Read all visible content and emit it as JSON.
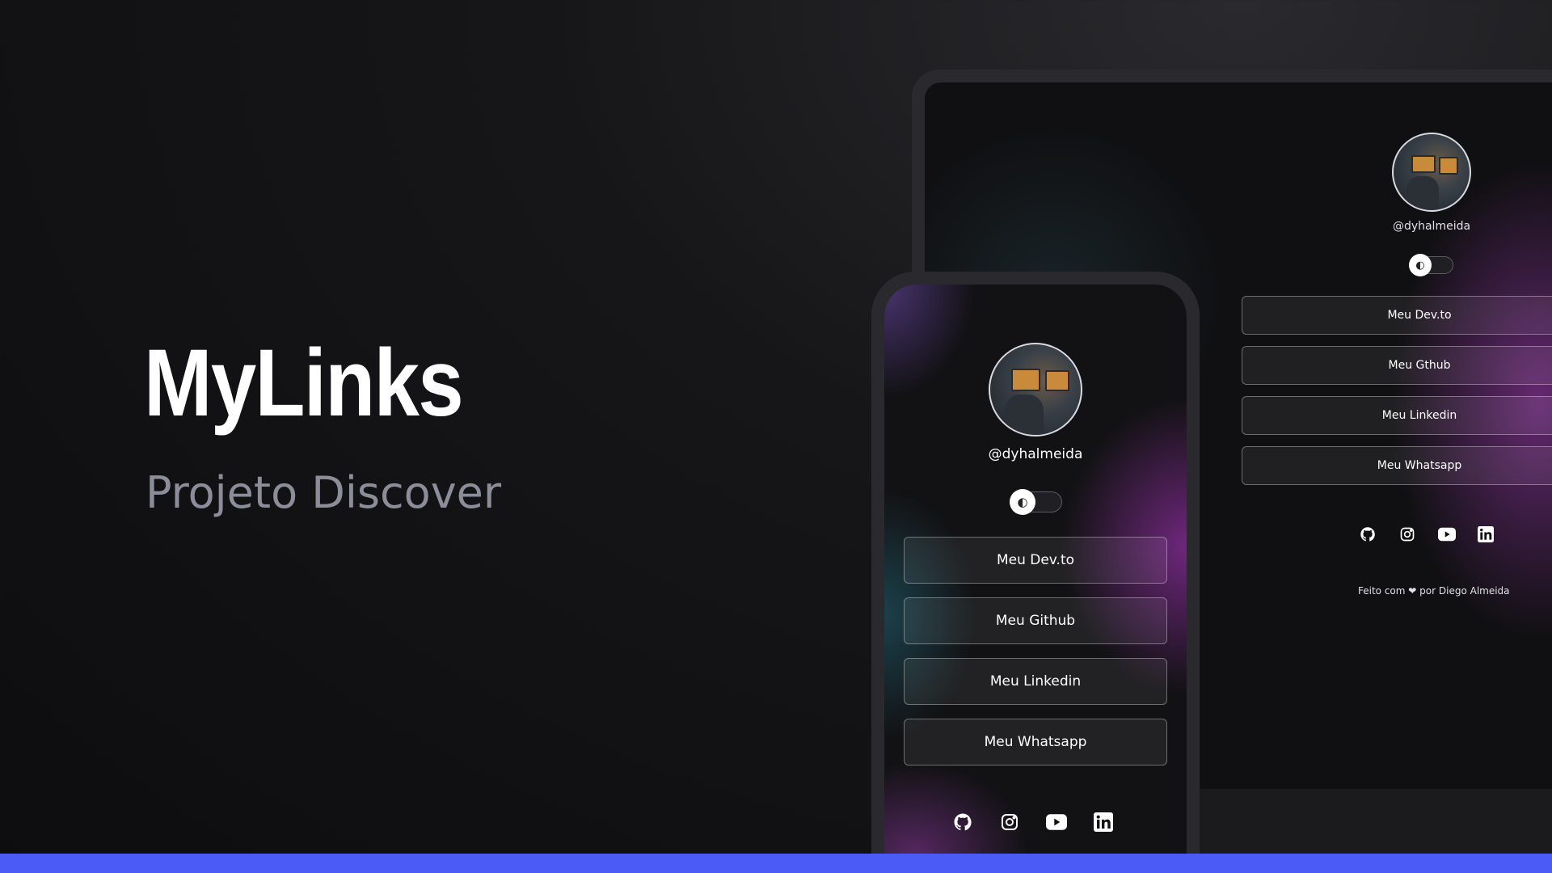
{
  "hero": {
    "title": "MyLinks",
    "subtitle": "Projeto Discover"
  },
  "profile": {
    "username": "@dyhalmeida",
    "avatar": "avatar-photo"
  },
  "theme_toggle": {
    "icon": "moon-sun-icon",
    "state": "off"
  },
  "links": [
    {
      "label": "Meu Dev.to"
    },
    {
      "label": "Meu Github"
    },
    {
      "label": "Meu Linkedin"
    },
    {
      "label": "Meu Whatsapp"
    }
  ],
  "desktop_links": [
    {
      "label": "Meu Dev.to"
    },
    {
      "label": "Meu Gthub"
    },
    {
      "label": "Meu Linkedin"
    },
    {
      "label": "Meu Whatsapp"
    }
  ],
  "social_icons": [
    "github-icon",
    "instagram-icon",
    "youtube-icon",
    "linkedin-icon"
  ],
  "footer": {
    "prefix": "Feito com",
    "suffix": "por Diego Almeida",
    "icon": "heart-icon"
  },
  "colors": {
    "accent_bar": "#4a5cf5",
    "subtitle": "#8d8d99",
    "background": "#0d0d0f"
  }
}
